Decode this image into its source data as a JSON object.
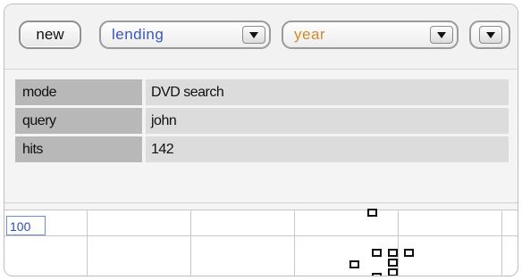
{
  "toolbar": {
    "new_label": "new",
    "lending_value": "lending",
    "year_value": "year"
  },
  "info": {
    "rows": [
      {
        "key": "mode",
        "value": "DVD search"
      },
      {
        "key": "query",
        "value": "john"
      },
      {
        "key": "hits",
        "value": "142"
      }
    ]
  },
  "chart": {
    "y_tick_label": "100"
  },
  "colors": {
    "lending_text": "#3a57b9",
    "year_text": "#d08a2a",
    "key_bg": "#b8b8b8",
    "value_bg": "#dcdcdc"
  }
}
